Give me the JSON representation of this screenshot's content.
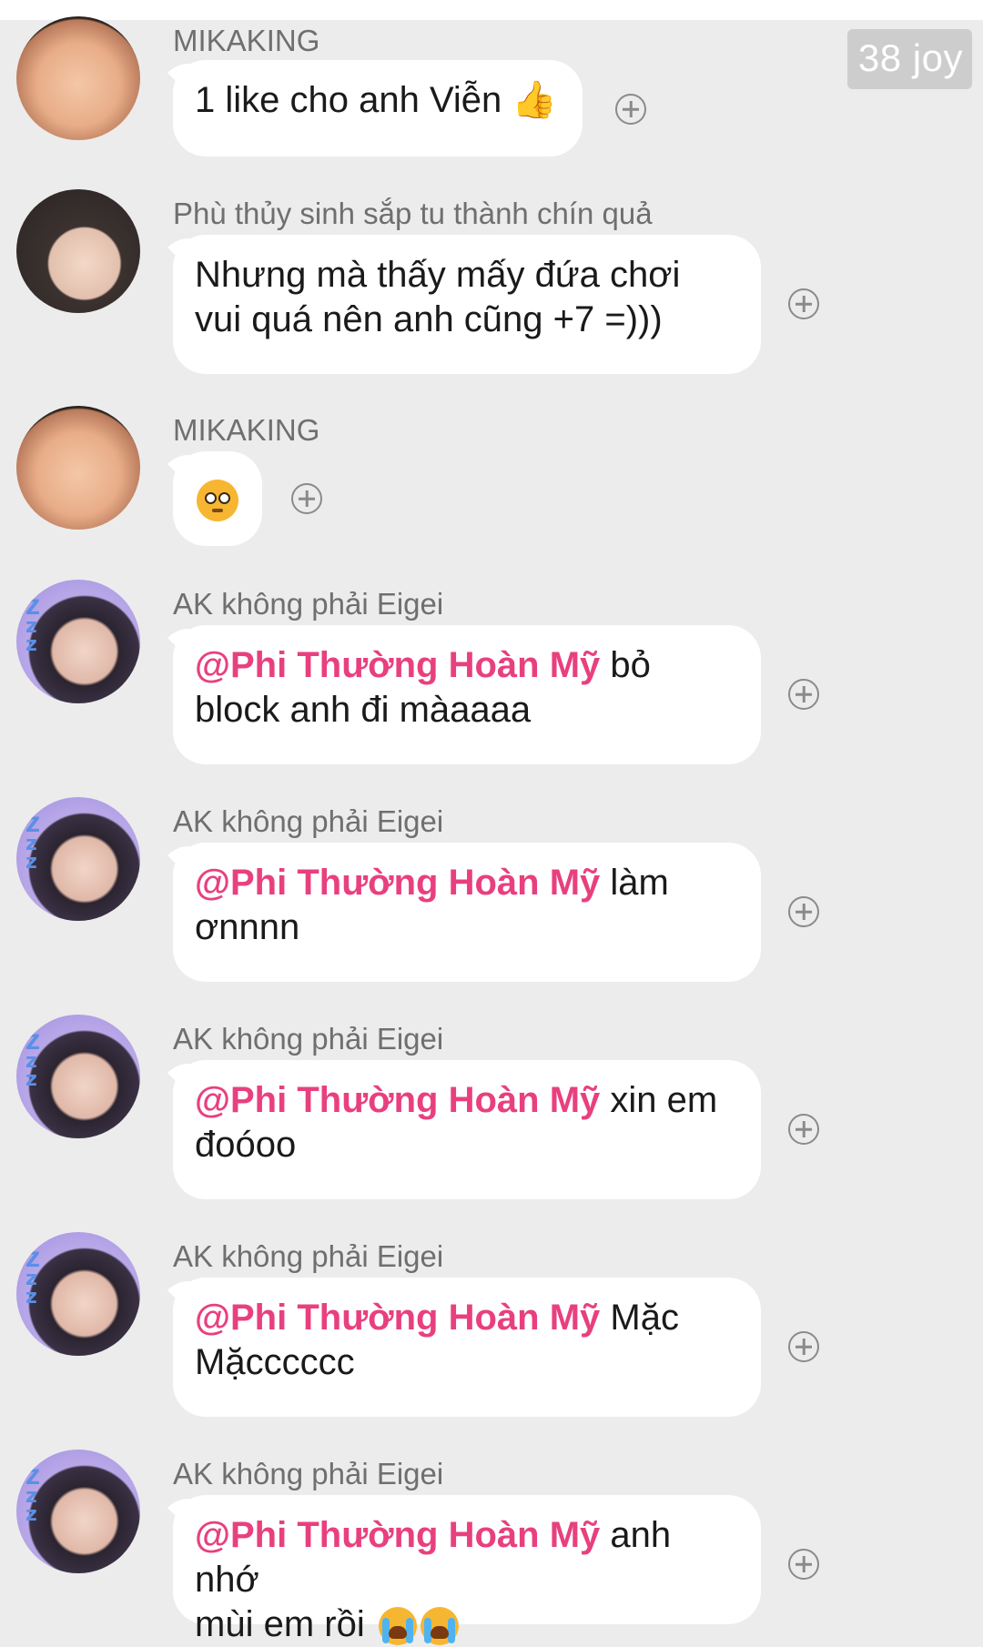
{
  "badge": "38 joy",
  "messages": [
    {
      "sender": "MIKAKING",
      "text": "1 like cho anh Viễn",
      "emoji": "thumbs-up-icon"
    },
    {
      "sender": "Phù thủy sinh sắp tu thành chín quả",
      "line1": "Nhưng mà thấy mấy đứa chơi",
      "line2": "vui quá nên anh cũng +7 =)))"
    },
    {
      "sender": "MIKAKING",
      "emoji": "pleading-face-icon"
    },
    {
      "sender": "AK không phải Eigei",
      "mention": "@Phi Thường Hoàn Mỹ",
      "rest1": " bỏ",
      "line2": "block anh đi màaaaa"
    },
    {
      "sender": "AK không phải Eigei",
      "mention": "@Phi Thường Hoàn Mỹ",
      "rest1": " làm",
      "line2": "ơnnnn"
    },
    {
      "sender": "AK không phải Eigei",
      "mention": "@Phi Thường Hoàn Mỹ",
      "rest1": " xin em",
      "line2": "đoóoo"
    },
    {
      "sender": "AK không phải Eigei",
      "mention": "@Phi Thường Hoàn Mỹ",
      "rest1": " Mặc",
      "line2": "Mặcccccc"
    },
    {
      "sender": "AK không phải Eigei",
      "mention": "@Phi Thường Hoàn Mỹ",
      "rest1": " anh nhớ",
      "line2": "mùi em rồi",
      "emoji": "loudly-crying-face-icon"
    }
  ]
}
